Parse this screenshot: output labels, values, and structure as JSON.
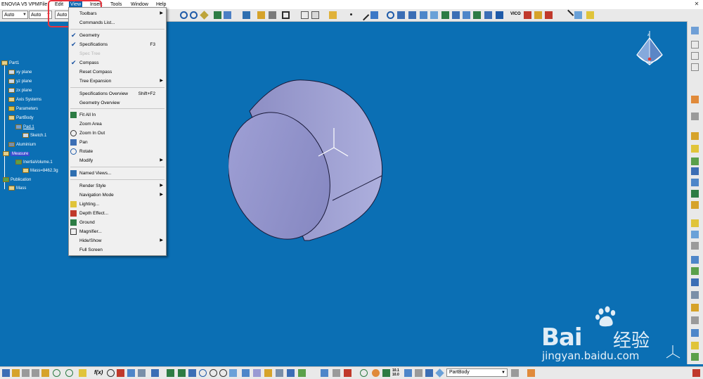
{
  "menubar": {
    "app_label": "ENOVIA V5 VPM",
    "items": [
      "File",
      "Edit",
      "View",
      "Insert",
      "Tools",
      "Window",
      "Help"
    ],
    "active": "View"
  },
  "toolbar": {
    "combos": [
      {
        "value": "Auto"
      },
      {
        "value": "Auto"
      },
      {
        "value": "Auto"
      }
    ],
    "vicon_label": "VICO"
  },
  "tree": {
    "nodes": [
      {
        "label": "Part1"
      },
      {
        "label": "xy plane"
      },
      {
        "label": "yz plane"
      },
      {
        "label": "zx plane"
      },
      {
        "label": "Axis Systems"
      },
      {
        "label": "Parameters"
      },
      {
        "label": "PartBody"
      },
      {
        "label": "Pad.1"
      },
      {
        "label": "Sketch.1"
      },
      {
        "label": "Aluminium"
      },
      {
        "label": "Measure"
      },
      {
        "label": "InertiaVolume.1"
      },
      {
        "label": "Mass=8462.3g"
      },
      {
        "label": "Publication"
      },
      {
        "label": "Mass"
      }
    ]
  },
  "view_menu": {
    "items": [
      {
        "label": "Toolbars",
        "shortcut": "",
        "submenu": true
      },
      {
        "label": "Commands List...",
        "shortcut": "",
        "submenu": false
      },
      {
        "label": "Geometry",
        "shortcut": "",
        "submenu": false,
        "checked": true
      },
      {
        "label": "Specifications",
        "shortcut": "F3",
        "submenu": false,
        "checked": true
      },
      {
        "label": "Spec Tree",
        "shortcut": "",
        "submenu": false,
        "disabled": true
      },
      {
        "label": "Compass",
        "shortcut": "",
        "submenu": false,
        "checked": true
      },
      {
        "label": "Reset Compass",
        "shortcut": "",
        "submenu": false
      },
      {
        "label": "Tree Expansion",
        "shortcut": "",
        "submenu": true
      },
      {
        "label": "Specifications Overview",
        "shortcut": "Shift+F2",
        "submenu": false
      },
      {
        "label": "Geometry Overview",
        "shortcut": "",
        "submenu": false
      },
      {
        "label": "Fit All In",
        "shortcut": "",
        "submenu": false
      },
      {
        "label": "Zoom Area",
        "shortcut": "",
        "submenu": false
      },
      {
        "label": "Zoom In Out",
        "shortcut": "",
        "submenu": false
      },
      {
        "label": "Pan",
        "shortcut": "",
        "submenu": false
      },
      {
        "label": "Rotate",
        "shortcut": "",
        "submenu": false
      },
      {
        "label": "Modify",
        "shortcut": "",
        "submenu": true
      },
      {
        "label": "Named Views...",
        "shortcut": "",
        "submenu": false
      },
      {
        "label": "Render Style",
        "shortcut": "",
        "submenu": true
      },
      {
        "label": "Navigation Mode",
        "shortcut": "",
        "submenu": true
      },
      {
        "label": "Lighting...",
        "shortcut": "",
        "submenu": false
      },
      {
        "label": "Depth Effect...",
        "shortcut": "",
        "submenu": false
      },
      {
        "label": "Ground",
        "shortcut": "",
        "submenu": false
      },
      {
        "label": "Magnifier...",
        "shortcut": "",
        "submenu": false
      },
      {
        "label": "Hide/Show",
        "shortcut": "",
        "submenu": true
      },
      {
        "label": "Full Screen",
        "shortcut": "",
        "submenu": false
      }
    ]
  },
  "bottom_toolbar": {
    "partbody_value": "PartBody",
    "ratio_label": "10.1 10.0"
  },
  "watermark": {
    "brand": "Bai",
    "brand_suffix": "经验",
    "url": "jingyan.baidu.com"
  },
  "colors": {
    "viewport": "#0b6fb4",
    "menu_active": "#0a64b0",
    "annotation": "#e8323c",
    "solid_face": "#9a9bd3"
  }
}
